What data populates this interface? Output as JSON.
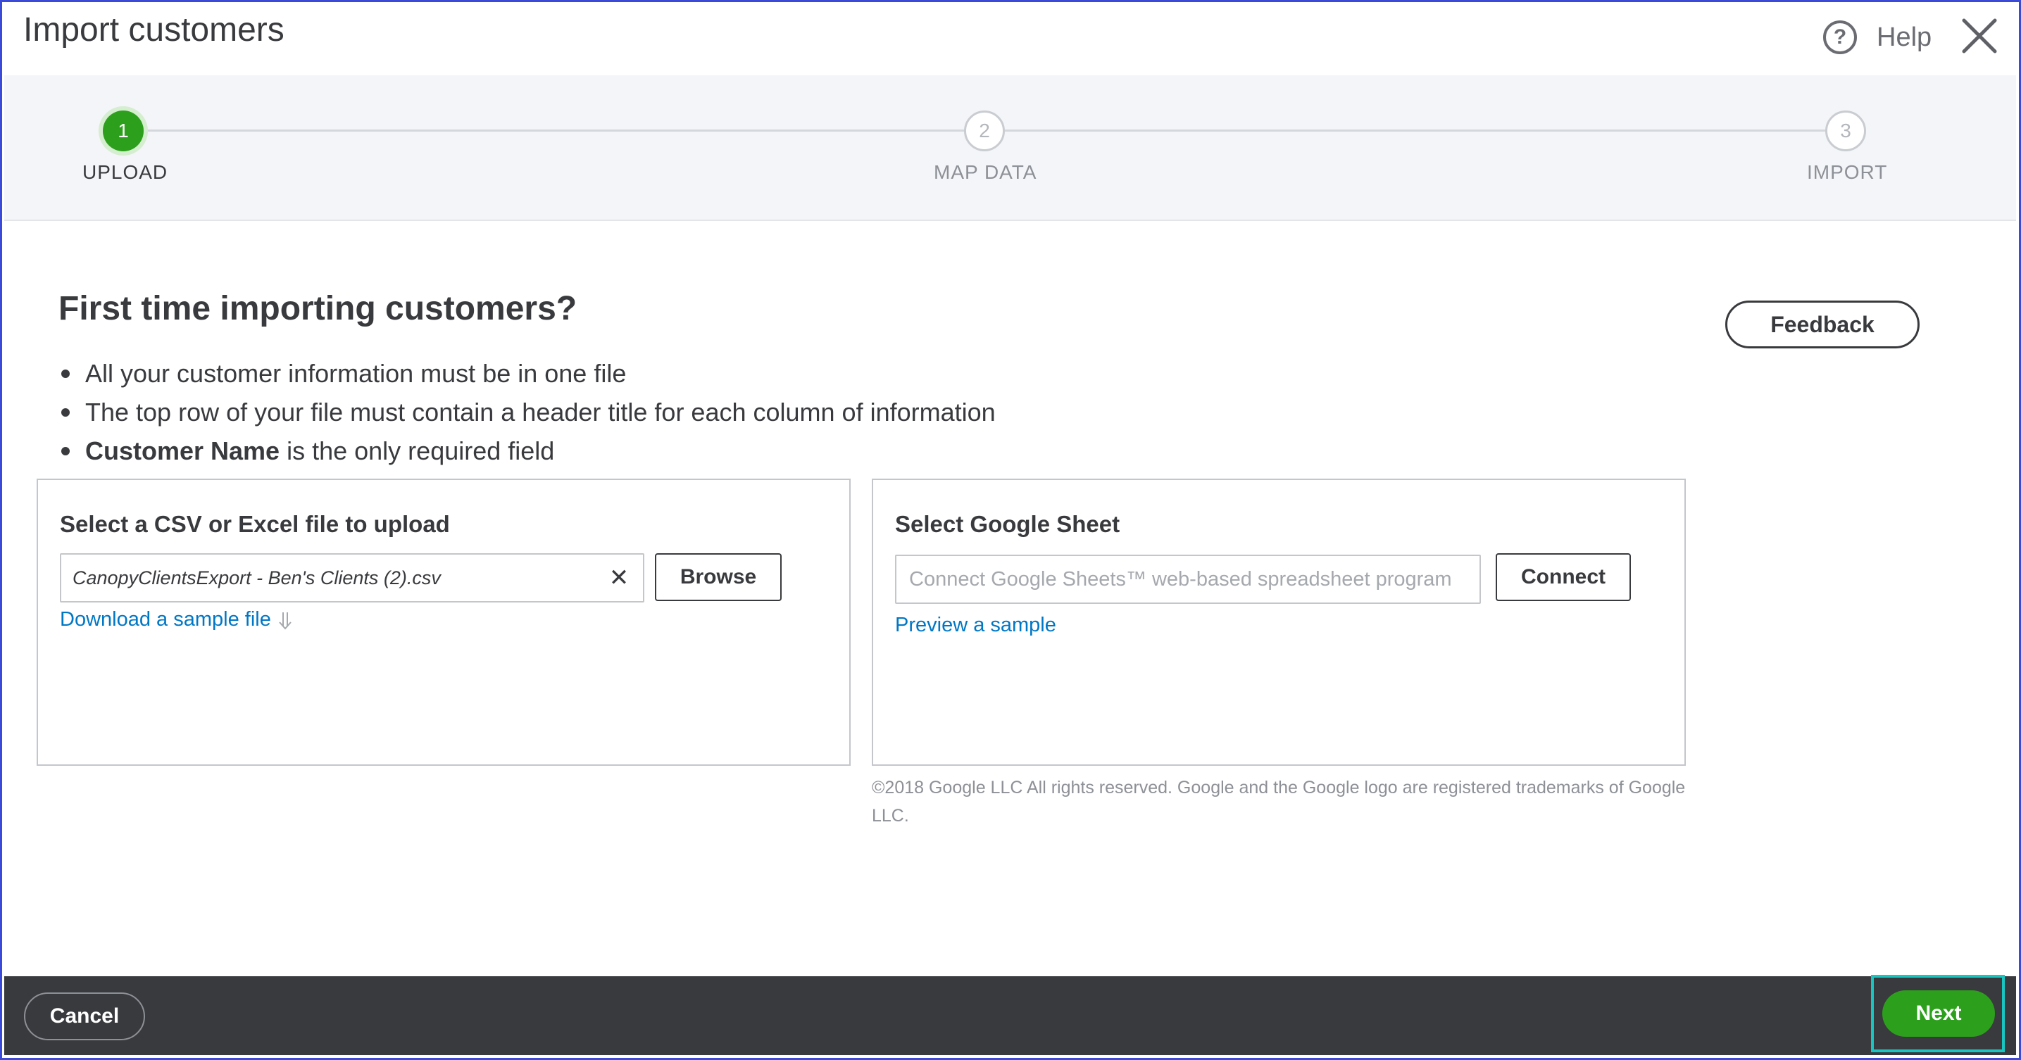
{
  "header": {
    "title": "Import customers",
    "help_label": "Help",
    "help_icon_glyph": "?"
  },
  "stepper": {
    "steps": [
      {
        "number": "1",
        "label": "UPLOAD",
        "state": "active"
      },
      {
        "number": "2",
        "label": "MAP DATA",
        "state": "pending"
      },
      {
        "number": "3",
        "label": "IMPORT",
        "state": "pending"
      }
    ]
  },
  "main": {
    "title": "First time importing customers?",
    "feedback_label": "Feedback",
    "bullets": [
      {
        "bold": "",
        "text": "All your customer information must be in one file"
      },
      {
        "bold": "",
        "text": "The top row of your file must contain a header title for each column of information"
      },
      {
        "bold": "Customer Name",
        "text": "is the only required field"
      }
    ]
  },
  "upload_panel": {
    "title": "Select a CSV or Excel file to upload",
    "file_value": "CanopyClientsExport - Ben's Clients (2).csv",
    "clear_glyph": "✕",
    "browse_label": "Browse",
    "sample_link": "Download a sample file"
  },
  "google_panel": {
    "title": "Select Google Sheet",
    "placeholder": "Connect Google Sheets™ web-based spreadsheet program",
    "connect_label": "Connect",
    "preview_link": "Preview a sample",
    "copyright": "©2018 Google LLC All rights reserved. Google and the Google logo are registered trademarks of Google LLC."
  },
  "footer": {
    "cancel_label": "Cancel",
    "next_label": "Next"
  },
  "colors": {
    "accent_green": "#2ca01c",
    "link_blue": "#0077c5",
    "footer_bg": "#393a3d",
    "highlight_teal": "#19c5c1",
    "frame_blue": "#3b4bd8"
  }
}
